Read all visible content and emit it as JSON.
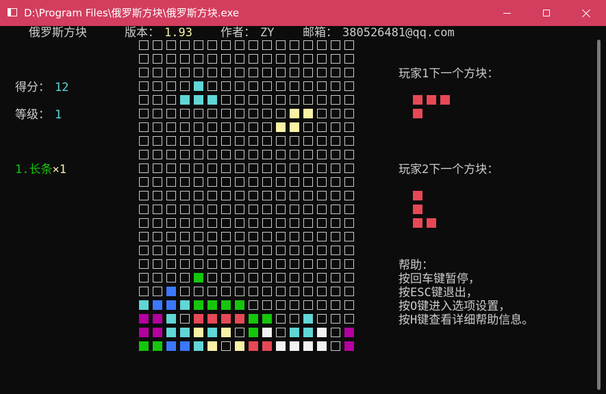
{
  "window": {
    "title": "D:\\Program Files\\俄罗斯方块\\俄罗斯方块.exe",
    "icon": "console-window-icon",
    "controls": [
      "minimize-icon",
      "maximize-icon",
      "close-icon"
    ],
    "title_bar_color": "#d33d5e"
  },
  "header": {
    "game_name": "俄罗斯方块",
    "version_label": "版本：",
    "version_value": "1.93",
    "author_label": "作者：",
    "author_value": "ZY",
    "email_label": "邮箱：",
    "email_value": "380526481@qq.com"
  },
  "stats": {
    "score_label": "得分：",
    "score_value": "12",
    "level_label": "等级：",
    "level_value": "1",
    "line_stat_prefix": "1.",
    "line_stat_name": "长条",
    "line_stat_count": "×1"
  },
  "player1": {
    "next_label": "玩家1下一个方块："
  },
  "player2": {
    "next_label": "玩家2下一个方块："
  },
  "help": {
    "title": "帮助：",
    "lines": [
      "按回车键暂停，",
      "按ESC键退出，",
      "按O键进入选项设置，",
      "按H键查看详细帮助信息。"
    ]
  },
  "board": {
    "cols": 16,
    "rows": 23,
    "cells": [
      "................",
      "................",
      "................",
      "....c...........",
      "...ccc..........",
      "...........yy...",
      "..........yy....",
      "................",
      "................",
      "................",
      "................",
      "................",
      "................",
      "................",
      "................",
      "................",
      "................",
      "....g...........",
      "..b.............",
      "cbbcgggg........",
      "mmc.rrrrgg..c...",
      "mmccycy.gw.ccw.mm",
      "ggbbcy.yrrwwww.m"
    ]
  },
  "next_pieces": {
    "player1": [
      "rrr",
      "r.."
    ],
    "player2": [
      "r.",
      "r.",
      "rr"
    ]
  },
  "colors": {
    "c": "#61d6d6",
    "y": "#f9f1a5",
    "g": "#16c60c",
    "b": "#3b78ff",
    "m": "#b4009e",
    "r": "#e74856",
    "w": "#f2f2f2",
    "empty_border": "#cccccc",
    "text": "#cccccc"
  }
}
